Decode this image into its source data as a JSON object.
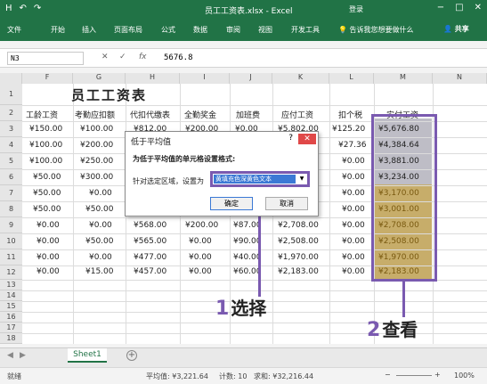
{
  "window": {
    "title": "员工工资表.xlsx - Excel",
    "login": "登录",
    "min": "−",
    "restore": "□",
    "close": "✕"
  },
  "qat": {
    "save_icon": "H",
    "undo_icon": "↶",
    "redo_icon": "↷"
  },
  "ribbon": {
    "tabs": [
      "文件",
      "开始",
      "插入",
      "页面布局",
      "公式",
      "数据",
      "审阅",
      "视图",
      "开发工具"
    ],
    "tell_me": "告诉我您想要做什么",
    "share": "共享"
  },
  "formula_bar": {
    "name_box": "N3",
    "cancel": "✕",
    "enter": "✓",
    "fx": "fx",
    "value": "5676.8"
  },
  "columns": [
    "F",
    "G",
    "H",
    "I",
    "J",
    "K",
    "L",
    "M",
    "N"
  ],
  "rows": [
    "1",
    "2",
    "3",
    "4",
    "5",
    "6",
    "7",
    "8",
    "9",
    "10",
    "11",
    "12",
    "13",
    "14",
    "15",
    "16",
    "17",
    "18"
  ],
  "sheet": {
    "title": "员工工资表",
    "headers": [
      "工龄工资",
      "考勤应扣额",
      "代扣代缴表",
      "全勤奖金",
      "加班费",
      "应付工资",
      "扣个税",
      "实付工资"
    ],
    "data": [
      [
        "¥150.00",
        "¥100.00",
        "¥812.00",
        "¥200.00",
        "¥0.00",
        "¥5,802.00",
        "¥125.20",
        "¥5,676.80"
      ],
      [
        "¥100.00",
        "¥200.00",
        "",
        "",
        "",
        "",
        "¥27.36",
        "¥4,384.64"
      ],
      [
        "¥100.00",
        "¥250.00",
        "",
        "",
        "",
        "",
        "¥0.00",
        "¥3,881.00"
      ],
      [
        "¥50.00",
        "¥300.00",
        "",
        "",
        "",
        "",
        "¥0.00",
        "¥3,234.00"
      ],
      [
        "¥50.00",
        "¥0.00",
        "",
        "",
        "",
        "",
        "¥0.00",
        "¥3,170.00"
      ],
      [
        "¥50.00",
        "¥50.00",
        "",
        "",
        "",
        "",
        "¥0.00",
        "¥3,001.00"
      ],
      [
        "¥0.00",
        "¥0.00",
        "¥568.00",
        "¥200.00",
        "¥87.00",
        "¥2,708.00",
        "¥0.00",
        "¥2,708.00"
      ],
      [
        "¥0.00",
        "¥50.00",
        "¥565.00",
        "¥0.00",
        "¥90.00",
        "¥2,508.00",
        "¥0.00",
        "¥2,508.00"
      ],
      [
        "¥0.00",
        "¥0.00",
        "¥477.00",
        "¥0.00",
        "¥40.00",
        "¥1,970.00",
        "¥0.00",
        "¥1,970.00"
      ],
      [
        "¥0.00",
        "¥15.00",
        "¥457.00",
        "¥0.00",
        "¥60.00",
        "¥2,183.00",
        "¥0.00",
        "¥2,183.00"
      ]
    ]
  },
  "dialog": {
    "title": "低于平均值",
    "help": "?",
    "close": "✕",
    "description": "为低于平均值的单元格设置格式:",
    "selection_label": "针对选定区域，设置为",
    "selected_option": "黄填充色深黄色文本",
    "ok": "确定",
    "cancel": "取消"
  },
  "callouts": [
    {
      "num": "1",
      "text": "选择"
    },
    {
      "num": "2",
      "text": "查看"
    }
  ],
  "sheet_tabs": {
    "active": "Sheet1",
    "add": "+"
  },
  "status": {
    "mode": "就绪",
    "average": "平均值: ¥3,221.64",
    "count": "计数: 10",
    "sum": "求和: ¥32,216.44",
    "zoom": "100%",
    "minus": "−",
    "plus": "+"
  },
  "colors": {
    "excel_green": "#217346",
    "highlight_dark_yellow": "#c7ad6a",
    "callout_purple": "#7a5ab0"
  }
}
